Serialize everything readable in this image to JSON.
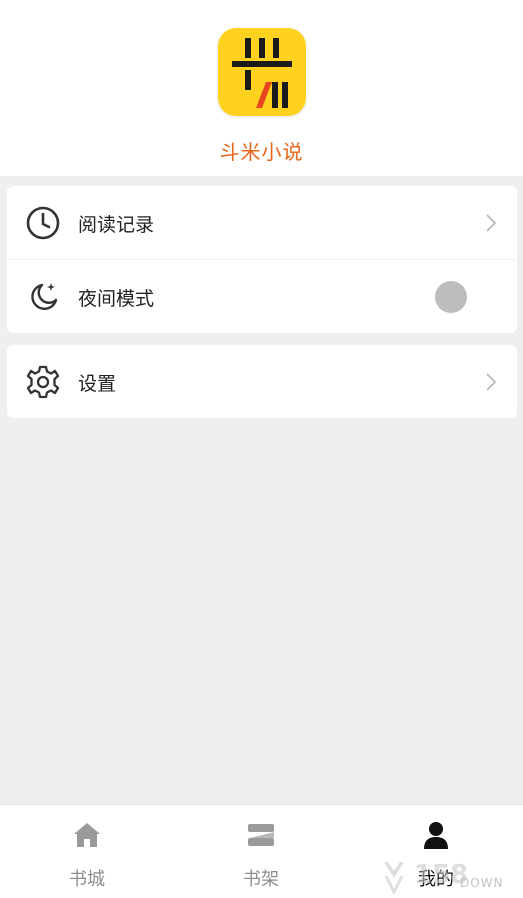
{
  "app": {
    "name": "斗米小说",
    "logo_color": "#ffd21f",
    "logo_accent": "#e8651c"
  },
  "menu": {
    "items": [
      {
        "label": "阅读记录",
        "icon": "clock-icon",
        "trailing": "chevron"
      },
      {
        "label": "夜间模式",
        "icon": "moon-icon",
        "trailing": "toggle",
        "toggle_on": false
      },
      {
        "label": "设置",
        "icon": "gear-icon",
        "trailing": "chevron"
      }
    ]
  },
  "tabbar": {
    "tabs": [
      {
        "label": "书城",
        "icon": "home-icon",
        "active": false
      },
      {
        "label": "书架",
        "icon": "bookshelf-icon",
        "active": false
      },
      {
        "label": "我的",
        "icon": "profile-icon",
        "active": true
      }
    ]
  },
  "watermark": {
    "number": "158",
    "text": "DOWN"
  }
}
